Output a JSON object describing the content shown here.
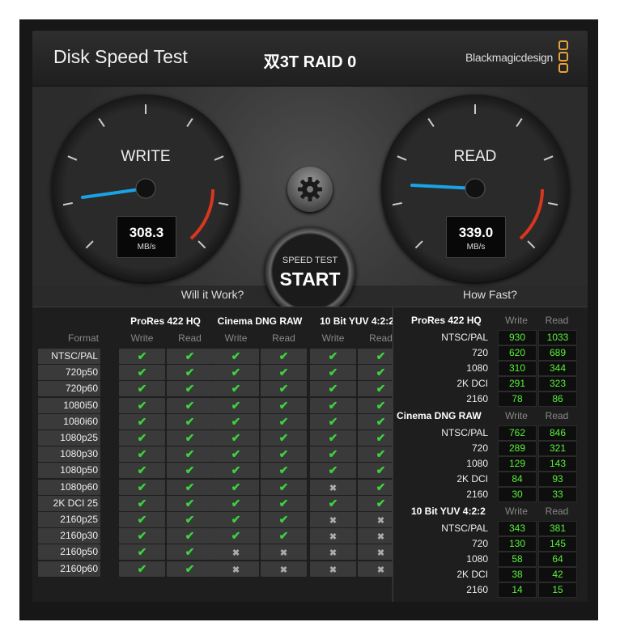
{
  "window": {
    "close_glyph": "×"
  },
  "header": {
    "app_title": "Disk Speed Test",
    "disk_name": "双3T RAID 0",
    "brand": "Blackmagicdesign"
  },
  "write_gauge": {
    "title": "WRITE",
    "value": "308.3",
    "unit": "MB/s"
  },
  "read_gauge": {
    "title": "READ",
    "value": "339.0",
    "unit": "MB/s"
  },
  "start_button": {
    "line1": "SPEED TEST",
    "line2": "START"
  },
  "settings_icon": "gear-icon",
  "will_it_work": {
    "title": "Will it Work?",
    "format_label": "Format",
    "groups": [
      {
        "name": "ProRes 422 HQ",
        "write": "Write",
        "read": "Read"
      },
      {
        "name": "Cinema DNG RAW",
        "write": "Write",
        "read": "Read"
      },
      {
        "name": "10 Bit YUV 4:2:2",
        "write": "Write",
        "read": "Read"
      }
    ],
    "rows": [
      {
        "format": "NTSC/PAL",
        "cells": [
          1,
          1,
          1,
          1,
          1,
          1
        ]
      },
      {
        "format": "720p50",
        "cells": [
          1,
          1,
          1,
          1,
          1,
          1
        ]
      },
      {
        "format": "720p60",
        "cells": [
          1,
          1,
          1,
          1,
          1,
          1
        ]
      },
      {
        "format": "1080i50",
        "cells": [
          1,
          1,
          1,
          1,
          1,
          1
        ]
      },
      {
        "format": "1080i60",
        "cells": [
          1,
          1,
          1,
          1,
          1,
          1
        ]
      },
      {
        "format": "1080p25",
        "cells": [
          1,
          1,
          1,
          1,
          1,
          1
        ]
      },
      {
        "format": "1080p30",
        "cells": [
          1,
          1,
          1,
          1,
          1,
          1
        ]
      },
      {
        "format": "1080p50",
        "cells": [
          1,
          1,
          1,
          1,
          1,
          1
        ]
      },
      {
        "format": "1080p60",
        "cells": [
          1,
          1,
          1,
          1,
          0,
          1
        ]
      },
      {
        "format": "2K DCI 25",
        "cells": [
          1,
          1,
          1,
          1,
          1,
          1
        ]
      },
      {
        "format": "2160p25",
        "cells": [
          1,
          1,
          1,
          1,
          0,
          0
        ]
      },
      {
        "format": "2160p30",
        "cells": [
          1,
          1,
          1,
          1,
          0,
          0
        ]
      },
      {
        "format": "2160p50",
        "cells": [
          1,
          1,
          0,
          0,
          0,
          0
        ]
      },
      {
        "format": "2160p60",
        "cells": [
          1,
          1,
          0,
          0,
          0,
          0
        ]
      }
    ],
    "check_glyph": "✔",
    "cross_glyph": "✖"
  },
  "how_fast": {
    "title": "How Fast?",
    "groups": [
      {
        "name": "ProRes 422 HQ",
        "write": "Write",
        "read": "Read",
        "rows": [
          {
            "format": "NTSC/PAL",
            "w": "930",
            "r": "1033"
          },
          {
            "format": "720",
            "w": "620",
            "r": "689"
          },
          {
            "format": "1080",
            "w": "310",
            "r": "344"
          },
          {
            "format": "2K DCI",
            "w": "291",
            "r": "323"
          },
          {
            "format": "2160",
            "w": "78",
            "r": "86"
          }
        ]
      },
      {
        "name": "Cinema DNG RAW",
        "write": "Write",
        "read": "Read",
        "rows": [
          {
            "format": "NTSC/PAL",
            "w": "762",
            "r": "846"
          },
          {
            "format": "720",
            "w": "289",
            "r": "321"
          },
          {
            "format": "1080",
            "w": "129",
            "r": "143"
          },
          {
            "format": "2K DCI",
            "w": "84",
            "r": "93"
          },
          {
            "format": "2160",
            "w": "30",
            "r": "33"
          }
        ]
      },
      {
        "name": "10 Bit YUV 4:2:2",
        "write": "Write",
        "read": "Read",
        "rows": [
          {
            "format": "NTSC/PAL",
            "w": "343",
            "r": "381"
          },
          {
            "format": "720",
            "w": "130",
            "r": "145"
          },
          {
            "format": "1080",
            "w": "58",
            "r": "64"
          },
          {
            "format": "2K DCI",
            "w": "38",
            "r": "42"
          },
          {
            "format": "2160",
            "w": "14",
            "r": "15"
          }
        ]
      }
    ]
  },
  "colors": {
    "accent_green": "#58f03a",
    "check_green": "#3ed23e",
    "needle_blue": "#19a3e6",
    "redline": "#d9361e",
    "brand_orange": "#e8a23a"
  }
}
